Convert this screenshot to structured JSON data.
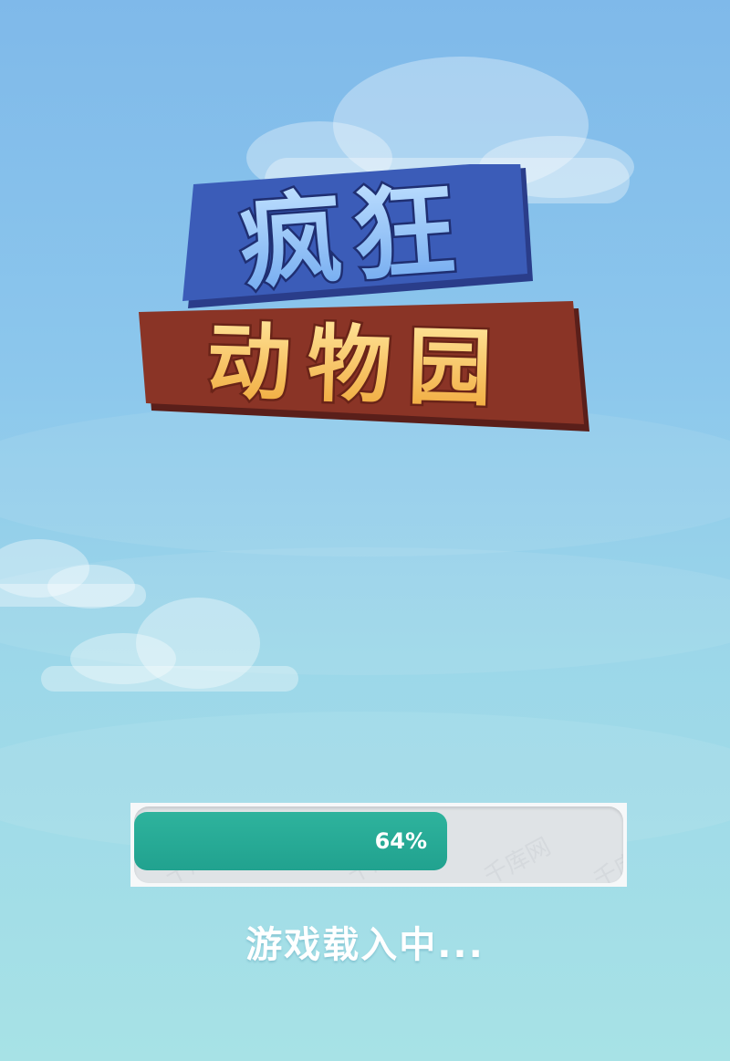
{
  "game": {
    "title_line1": "疯狂",
    "title_line2": "动物园"
  },
  "loading": {
    "progress": 0.64,
    "percent_text": "64%",
    "status_text": "游戏载入中..."
  },
  "watermark": {
    "text": "千库网"
  },
  "colors": {
    "sky_top": "#7fb9ea",
    "sky_bottom": "#a7e2e6",
    "progress_fill": "#24a692",
    "progress_track": "#dfe3e6",
    "title_blue": "#8ec3f4",
    "title_gold": "#f6b746"
  }
}
